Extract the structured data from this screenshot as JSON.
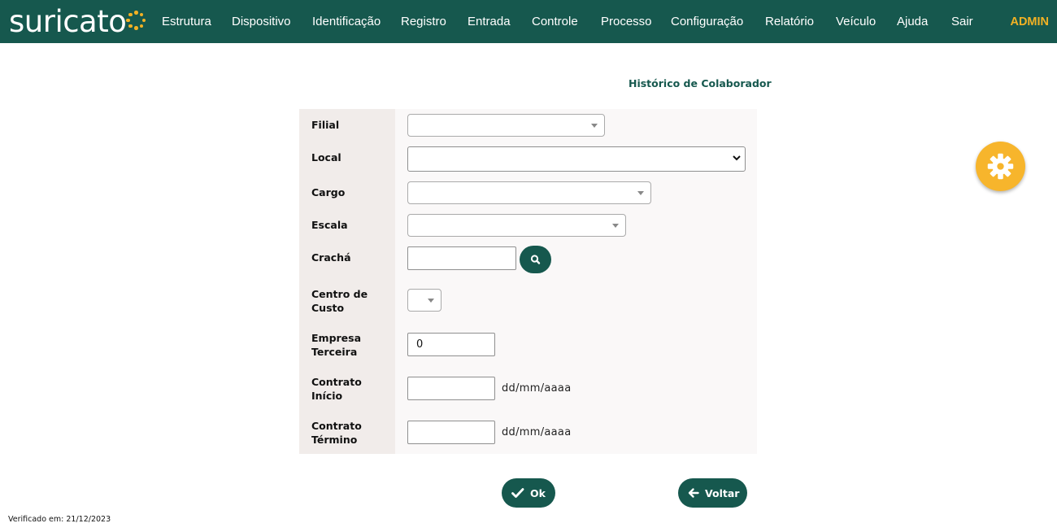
{
  "brand": {
    "logo_text": "suricato"
  },
  "nav": {
    "items": [
      "Estrutura",
      "Dispositivo",
      "Identificação",
      "Registro",
      "Entrada",
      "Controle",
      "Processo",
      "Configuração",
      "Relatório",
      "Veículo",
      "Ajuda",
      "Sair"
    ],
    "user": "ADMIN"
  },
  "page": {
    "title": "Histórico de Colaborador"
  },
  "form": {
    "filial": {
      "label": "Filial",
      "value": ""
    },
    "local": {
      "label": "Local",
      "value": ""
    },
    "cargo": {
      "label": "Cargo",
      "value": ""
    },
    "escala": {
      "label": "Escala",
      "value": ""
    },
    "cracha": {
      "label": "Crachá",
      "value": ""
    },
    "centro_custo": {
      "label_line1": "Centro de",
      "label_line2": "Custo",
      "value": ""
    },
    "empresa_terceira": {
      "label_line1": "Empresa",
      "label_line2": "Terceira",
      "value": "0"
    },
    "contrato_inicio": {
      "label_line1": "Contrato",
      "label_line2": "Início",
      "value": "",
      "hint": "dd/mm/aaaa"
    },
    "contrato_termino": {
      "label_line1": "Contrato",
      "label_line2": "Término",
      "value": "",
      "hint": "dd/mm/aaaa"
    }
  },
  "actions": {
    "ok_label": "Ok",
    "back_label": "Voltar"
  },
  "footer": {
    "verified": "Verificado em: 21/12/2023"
  },
  "colors": {
    "primary": "#16584e",
    "accent": "#f2b124",
    "label_bg": "#f1ecea",
    "panel_bg": "#faf8f8"
  },
  "icons": {
    "search": "magnifier-icon",
    "ok": "check-icon",
    "back": "arrow-left-icon",
    "settings": "gear-icon"
  }
}
